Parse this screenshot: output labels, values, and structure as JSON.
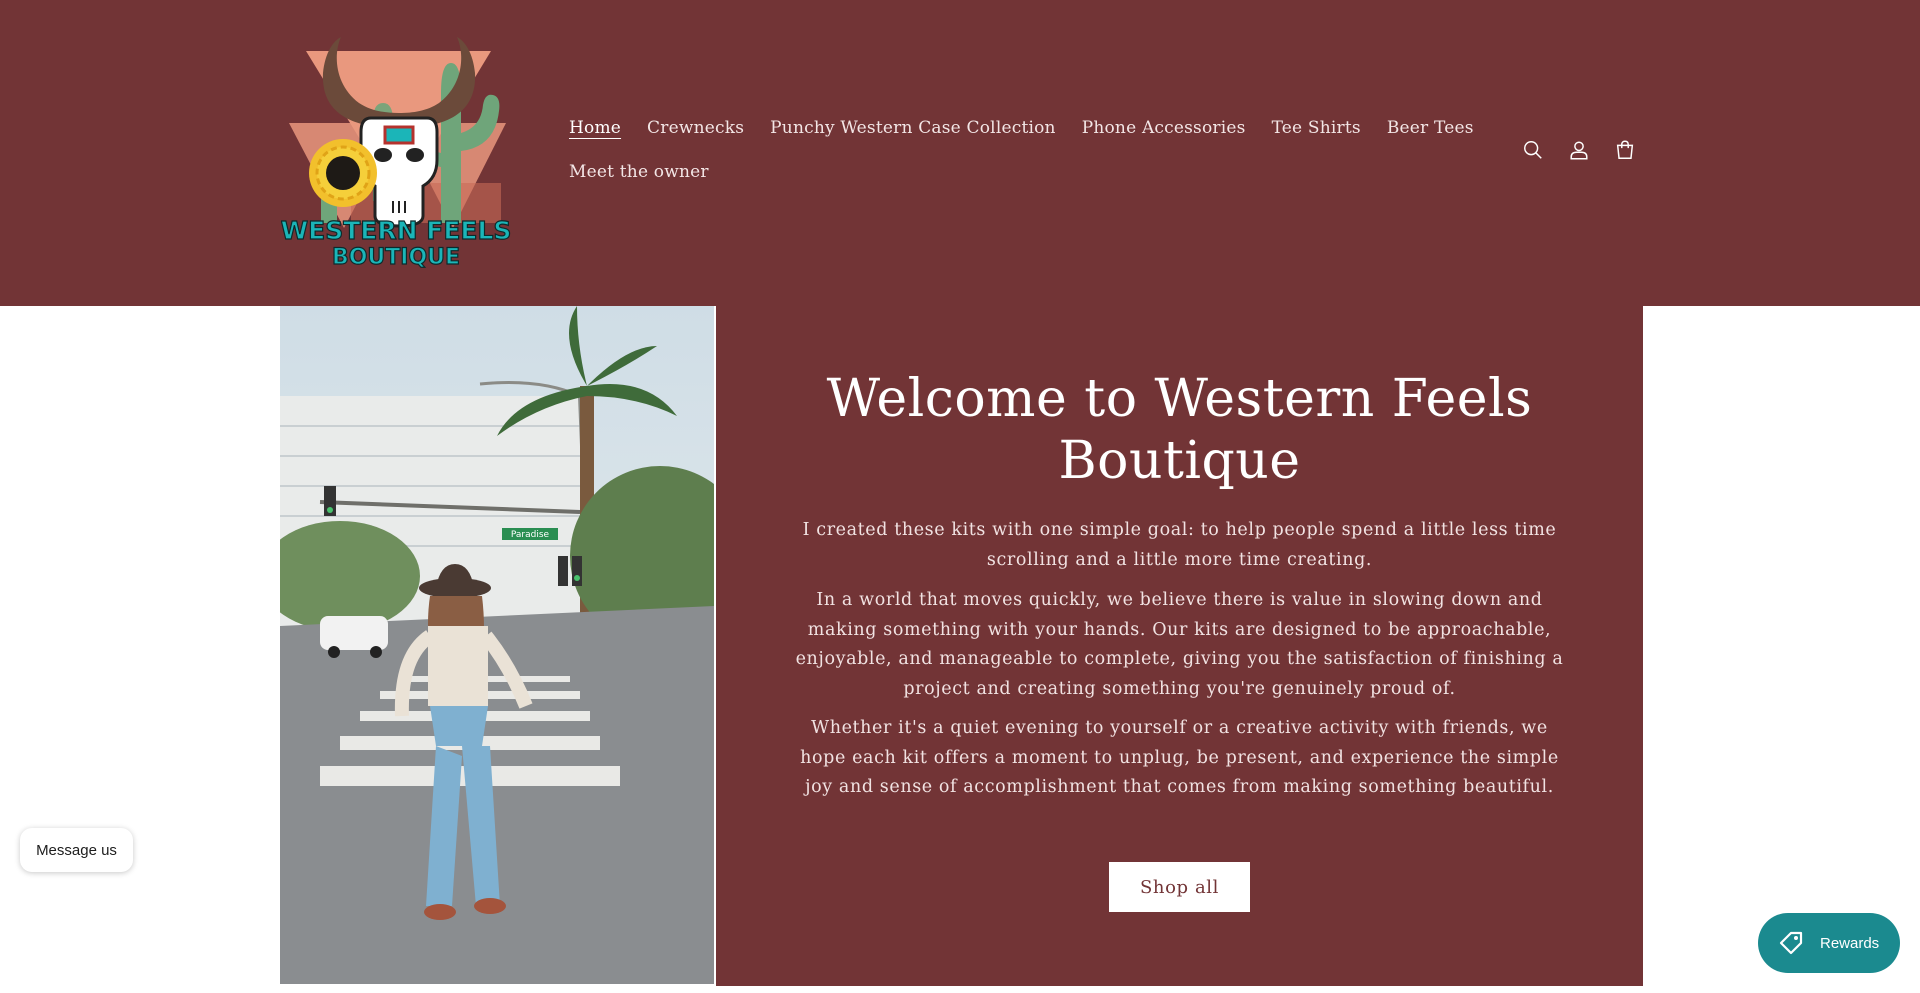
{
  "brand": {
    "logo_line1": "WESTERN FEELS",
    "logo_line2": "BOUTIQUE"
  },
  "nav": {
    "items": [
      {
        "label": "Home",
        "active": true
      },
      {
        "label": "Crewnecks"
      },
      {
        "label": "Punchy Western Case Collection"
      },
      {
        "label": "Phone Accessories"
      },
      {
        "label": "Tee Shirts"
      },
      {
        "label": "Beer Tees"
      },
      {
        "label": "Meet the owner"
      }
    ]
  },
  "header_icons": [
    "search-icon",
    "account-icon",
    "cart-icon"
  ],
  "hero": {
    "heading_line1": "Welcome to Western Feels",
    "heading_line2": "Boutique",
    "paragraphs": [
      "I created these kits with one simple goal: to help people spend a little less time scrolling and a little more time creating.",
      "In a world that moves quickly, we believe there is value in slowing down and making something with your hands. Our kits are designed to be approachable, enjoyable, and manageable to complete, giving you the satisfaction of finishing a project and creating something you're genuinely proud of.",
      "Whether it's a quiet evening to yourself or a creative activity with friends, we hope each kit offers a moment to unplug, be present, and experience the simple joy and sense of accomplishment that comes from making something beautiful."
    ],
    "button_label": "Shop all",
    "photo_sign": "Paradise"
  },
  "widgets": {
    "message_label": "Message us",
    "rewards_label": "Rewards"
  },
  "colors": {
    "brand_maroon": "#723436",
    "rewards_teal": "#1b8a8f",
    "logo_turquoise": "#1bb5b8"
  }
}
